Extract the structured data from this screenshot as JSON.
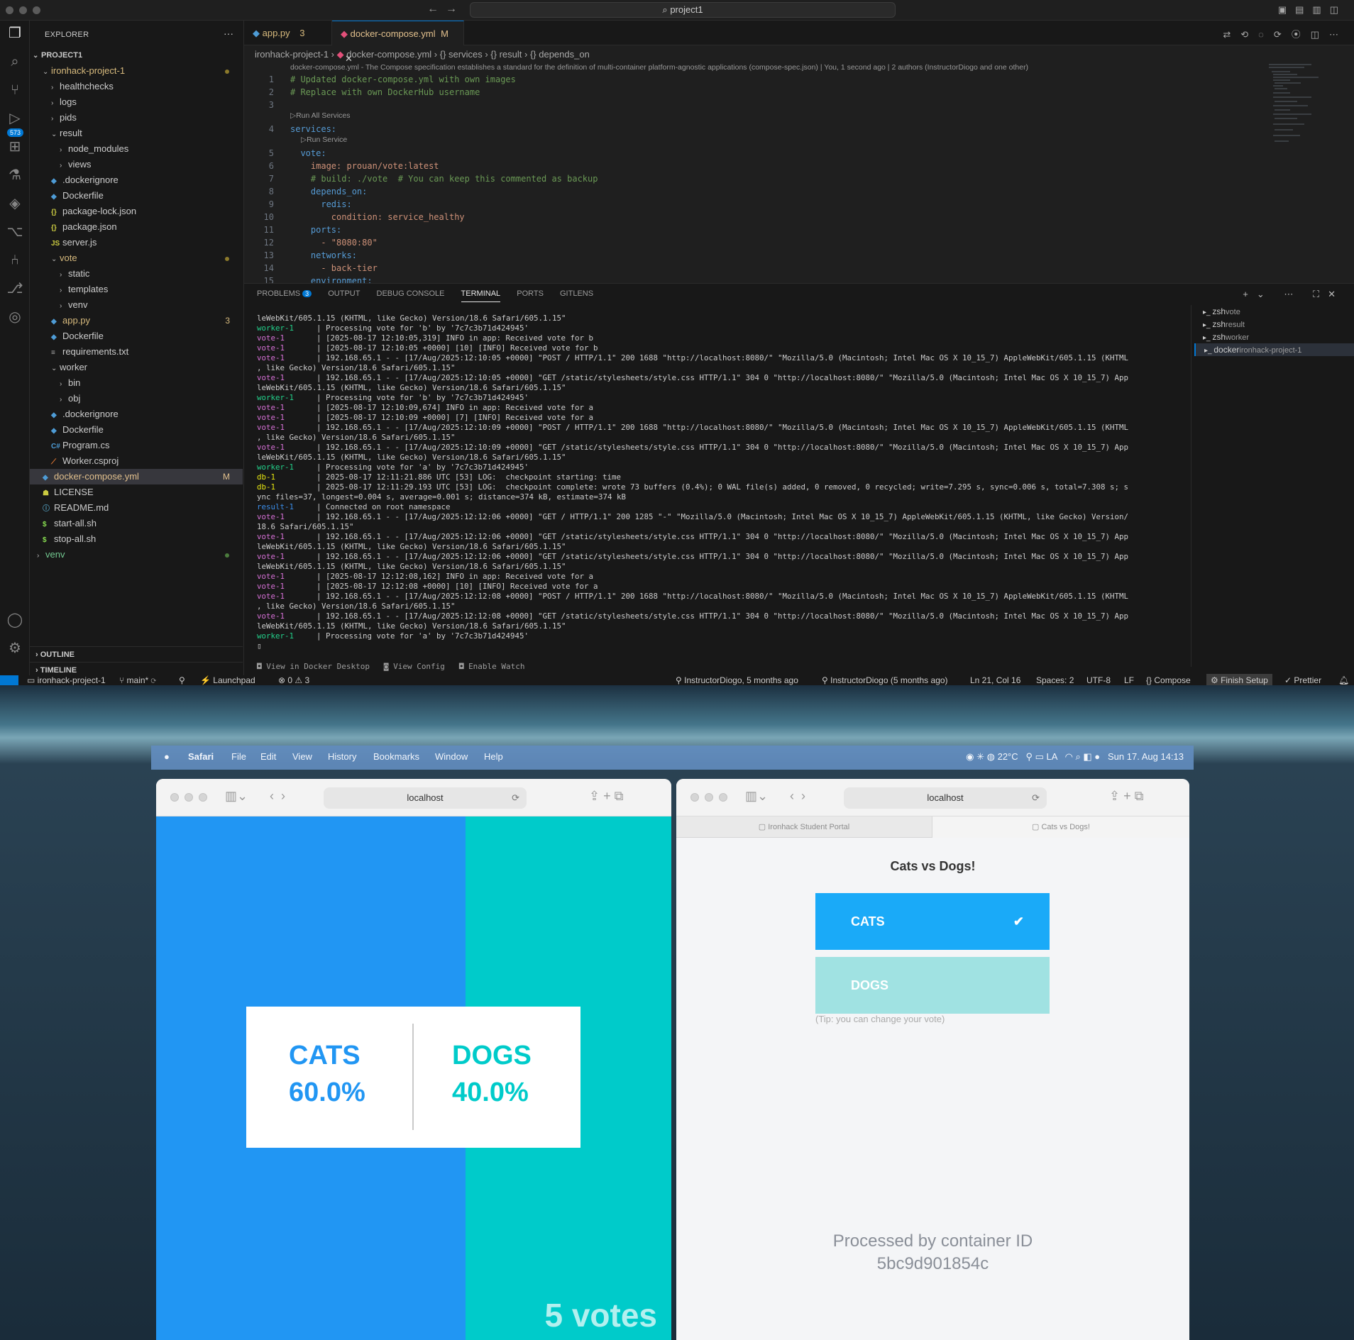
{
  "vscode": {
    "title_search": "project1",
    "explorer": {
      "header": "EXPLORER",
      "root": "PROJECT1",
      "items": [
        {
          "label": "ironhack-project-1",
          "kind": "folder-open",
          "depth": 0,
          "color": "#d7ba7d",
          "dot": "mod"
        },
        {
          "label": "healthchecks",
          "kind": "folder",
          "depth": 1
        },
        {
          "label": "logs",
          "kind": "folder",
          "depth": 1
        },
        {
          "label": "pids",
          "kind": "folder",
          "depth": 1
        },
        {
          "label": "result",
          "kind": "folder-open",
          "depth": 1
        },
        {
          "label": "node_modules",
          "kind": "folder",
          "depth": 2
        },
        {
          "label": "views",
          "kind": "folder",
          "depth": 2
        },
        {
          "label": ".dockerignore",
          "kind": "file",
          "depth": 1,
          "icon": "docker-icon"
        },
        {
          "label": "Dockerfile",
          "kind": "file",
          "depth": 1,
          "icon": "docker-icon"
        },
        {
          "label": "package-lock.json",
          "kind": "file",
          "depth": 1,
          "icon": "json-icon"
        },
        {
          "label": "package.json",
          "kind": "file",
          "depth": 1,
          "icon": "json-icon"
        },
        {
          "label": "server.js",
          "kind": "file",
          "depth": 1,
          "icon": "js-icon"
        },
        {
          "label": "vote",
          "kind": "folder-open",
          "depth": 1,
          "color": "#d7ba7d",
          "dot": "mod"
        },
        {
          "label": "static",
          "kind": "folder",
          "depth": 2
        },
        {
          "label": "templates",
          "kind": "folder",
          "depth": 2
        },
        {
          "label": "venv",
          "kind": "folder",
          "depth": 2
        },
        {
          "label": "app.py",
          "kind": "file",
          "depth": 1,
          "icon": "python-icon",
          "color": "#d7ba7d",
          "status": "3"
        },
        {
          "label": "Dockerfile",
          "kind": "file",
          "depth": 1,
          "icon": "docker-icon"
        },
        {
          "label": "requirements.txt",
          "kind": "file",
          "depth": 1,
          "icon": "text-icon"
        },
        {
          "label": "worker",
          "kind": "folder-open",
          "depth": 1
        },
        {
          "label": "bin",
          "kind": "folder",
          "depth": 2
        },
        {
          "label": "obj",
          "kind": "folder",
          "depth": 2
        },
        {
          "label": ".dockerignore",
          "kind": "file",
          "depth": 1,
          "icon": "docker-icon"
        },
        {
          "label": "Dockerfile",
          "kind": "file",
          "depth": 1,
          "icon": "docker-icon"
        },
        {
          "label": "Program.cs",
          "kind": "file",
          "depth": 1,
          "icon": "csharp-icon"
        },
        {
          "label": "Worker.csproj",
          "kind": "file",
          "depth": 1,
          "icon": "xml-icon"
        },
        {
          "label": "docker-compose.yml",
          "kind": "file",
          "depth": 0,
          "icon": "docker-icon",
          "color": "#e2c08d",
          "status": "M",
          "selected": true
        },
        {
          "label": "LICENSE",
          "kind": "file",
          "depth": 0,
          "icon": "license-icon"
        },
        {
          "label": "README.md",
          "kind": "file",
          "depth": 0,
          "icon": "info-icon"
        },
        {
          "label": "start-all.sh",
          "kind": "file",
          "depth": 0,
          "icon": "shell-icon"
        },
        {
          "label": "stop-all.sh",
          "kind": "file",
          "depth": 0,
          "icon": "shell-icon"
        },
        {
          "label": "venv",
          "kind": "folder",
          "depth": -1,
          "color": "#73c991",
          "dot": "green"
        }
      ],
      "outline": "OUTLINE",
      "timeline": "TIMELINE"
    },
    "activity": {
      "scm_badge": "573"
    },
    "tabs": [
      {
        "label": "app.py",
        "badge": "3",
        "active": false
      },
      {
        "label": "docker-compose.yml",
        "badge": "M",
        "active": true
      }
    ],
    "breadcrumb": [
      "ironhack-project-1",
      "docker-compose.yml",
      "{} services",
      "{} result",
      "{} depends_on"
    ],
    "codelens_top": "docker-compose.yml - The Compose specification establishes a standard for the definition of multi-container platform-agnostic applications (compose-spec.json) | You, 1 second ago | 2 authors (InstructorDiogo and one other)",
    "code_lines": [
      {
        "n": "1",
        "t": "# Updated docker-compose.yml with own images",
        "c": "#6a9955"
      },
      {
        "n": "2",
        "t": "# Replace with own DockerHub username",
        "c": "#6a9955"
      },
      {
        "n": "3",
        "t": "",
        "c": "#cccccc"
      },
      {
        "n": "4",
        "t": "services:",
        "c": "#569cd6",
        "lens": "▷Run All Services"
      },
      {
        "n": "5",
        "t": "  vote:",
        "c": "#569cd6",
        "lens": "▷Run Service"
      },
      {
        "n": "6",
        "t": "    image: prouan/vote:latest",
        "c": "#ce9178"
      },
      {
        "n": "7",
        "t": "    # build: ./vote  # You can keep this commented as backup",
        "c": "#6a9955"
      },
      {
        "n": "8",
        "t": "    depends_on:",
        "c": "#569cd6"
      },
      {
        "n": "9",
        "t": "      redis:",
        "c": "#569cd6"
      },
      {
        "n": "10",
        "t": "        condition: service_healthy",
        "c": "#ce9178"
      },
      {
        "n": "11",
        "t": "    ports:",
        "c": "#569cd6"
      },
      {
        "n": "12",
        "t": "      - \"8080:80\"",
        "c": "#ce9178"
      },
      {
        "n": "13",
        "t": "    networks:",
        "c": "#569cd6"
      },
      {
        "n": "14",
        "t": "      - back-tier",
        "c": "#ce9178"
      },
      {
        "n": "15",
        "t": "    environment:",
        "c": "#569cd6"
      }
    ],
    "panel_tabs": [
      {
        "label": "PROBLEMS",
        "badge": "3"
      },
      {
        "label": "OUTPUT"
      },
      {
        "label": "DEBUG CONSOLE"
      },
      {
        "label": "TERMINAL",
        "active": true
      },
      {
        "label": "PORTS"
      },
      {
        "label": "GITLENS"
      }
    ],
    "terminal_lines": [
      {
        "svc": "",
        "c": "#cccccc",
        "t": "leWebKit/605.1.15 (KHTML, like Gecko) Version/18.6 Safari/605.1.15\""
      },
      {
        "svc": "worker-1",
        "c": "#23d18b",
        "t": "| Processing vote for 'b' by '7c7c3b71d424945'"
      },
      {
        "svc": "vote-1",
        "c": "#d670d6",
        "t": "| [2025-08-17 12:10:05,319] INFO in app: Received vote for b"
      },
      {
        "svc": "vote-1",
        "c": "#d670d6",
        "t": "| [2025-08-17 12:10:05 +0000] [10] [INFO] Received vote for b"
      },
      {
        "svc": "vote-1",
        "c": "#d670d6",
        "t": "| 192.168.65.1 - - [17/Aug/2025:12:10:05 +0000] \"POST / HTTP/1.1\" 200 1688 \"http://localhost:8080/\" \"Mozilla/5.0 (Macintosh; Intel Mac OS X 10_15_7) AppleWebKit/605.1.15 (KHTML"
      },
      {
        "svc": "",
        "c": "#cccccc",
        "t": ", like Gecko) Version/18.6 Safari/605.1.15\""
      },
      {
        "svc": "vote-1",
        "c": "#d670d6",
        "t": "| 192.168.65.1 - - [17/Aug/2025:12:10:05 +0000] \"GET /static/stylesheets/style.css HTTP/1.1\" 304 0 \"http://localhost:8080/\" \"Mozilla/5.0 (Macintosh; Intel Mac OS X 10_15_7) App"
      },
      {
        "svc": "",
        "c": "#cccccc",
        "t": "leWebKit/605.1.15 (KHTML, like Gecko) Version/18.6 Safari/605.1.15\""
      },
      {
        "svc": "worker-1",
        "c": "#23d18b",
        "t": "| Processing vote for 'b' by '7c7c3b71d424945'"
      },
      {
        "svc": "vote-1",
        "c": "#d670d6",
        "t": "| [2025-08-17 12:10:09,674] INFO in app: Received vote for a"
      },
      {
        "svc": "vote-1",
        "c": "#d670d6",
        "t": "| [2025-08-17 12:10:09 +0000] [7] [INFO] Received vote for a"
      },
      {
        "svc": "vote-1",
        "c": "#d670d6",
        "t": "| 192.168.65.1 - - [17/Aug/2025:12:10:09 +0000] \"POST / HTTP/1.1\" 200 1688 \"http://localhost:8080/\" \"Mozilla/5.0 (Macintosh; Intel Mac OS X 10_15_7) AppleWebKit/605.1.15 (KHTML"
      },
      {
        "svc": "",
        "c": "#cccccc",
        "t": ", like Gecko) Version/18.6 Safari/605.1.15\""
      },
      {
        "svc": "vote-1",
        "c": "#d670d6",
        "t": "| 192.168.65.1 - - [17/Aug/2025:12:10:09 +0000] \"GET /static/stylesheets/style.css HTTP/1.1\" 304 0 \"http://localhost:8080/\" \"Mozilla/5.0 (Macintosh; Intel Mac OS X 10_15_7) App"
      },
      {
        "svc": "",
        "c": "#cccccc",
        "t": "leWebKit/605.1.15 (KHTML, like Gecko) Version/18.6 Safari/605.1.15\""
      },
      {
        "svc": "worker-1",
        "c": "#23d18b",
        "t": "| Processing vote for 'a' by '7c7c3b71d424945'"
      },
      {
        "svc": "db-1",
        "c": "#e5e510",
        "t": "| 2025-08-17 12:11:21.886 UTC [53] LOG:  checkpoint starting: time"
      },
      {
        "svc": "db-1",
        "c": "#e5e510",
        "t": "| 2025-08-17 12:11:29.193 UTC [53] LOG:  checkpoint complete: wrote 73 buffers (0.4%); 0 WAL file(s) added, 0 removed, 0 recycled; write=7.295 s, sync=0.006 s, total=7.308 s; s"
      },
      {
        "svc": "",
        "c": "#cccccc",
        "t": "ync files=37, longest=0.004 s, average=0.001 s; distance=374 kB, estimate=374 kB"
      },
      {
        "svc": "result-1",
        "c": "#3b8eea",
        "t": "| Connected on root namespace"
      },
      {
        "svc": "vote-1",
        "c": "#d670d6",
        "t": "| 192.168.65.1 - - [17/Aug/2025:12:12:06 +0000] \"GET / HTTP/1.1\" 200 1285 \"-\" \"Mozilla/5.0 (Macintosh; Intel Mac OS X 10_15_7) AppleWebKit/605.1.15 (KHTML, like Gecko) Version/"
      },
      {
        "svc": "",
        "c": "#cccccc",
        "t": "18.6 Safari/605.1.15\""
      },
      {
        "svc": "vote-1",
        "c": "#d670d6",
        "t": "| 192.168.65.1 - - [17/Aug/2025:12:12:06 +0000] \"GET /static/stylesheets/style.css HTTP/1.1\" 304 0 \"http://localhost:8080/\" \"Mozilla/5.0 (Macintosh; Intel Mac OS X 10_15_7) App"
      },
      {
        "svc": "",
        "c": "#cccccc",
        "t": "leWebKit/605.1.15 (KHTML, like Gecko) Version/18.6 Safari/605.1.15\""
      },
      {
        "svc": "vote-1",
        "c": "#d670d6",
        "t": "| 192.168.65.1 - - [17/Aug/2025:12:12:06 +0000] \"GET /static/stylesheets/style.css HTTP/1.1\" 304 0 \"http://localhost:8080/\" \"Mozilla/5.0 (Macintosh; Intel Mac OS X 10_15_7) App"
      },
      {
        "svc": "",
        "c": "#cccccc",
        "t": "leWebKit/605.1.15 (KHTML, like Gecko) Version/18.6 Safari/605.1.15\""
      },
      {
        "svc": "vote-1",
        "c": "#d670d6",
        "t": "| [2025-08-17 12:12:08,162] INFO in app: Received vote for a"
      },
      {
        "svc": "vote-1",
        "c": "#d670d6",
        "t": "| [2025-08-17 12:12:08 +0000] [10] [INFO] Received vote for a"
      },
      {
        "svc": "vote-1",
        "c": "#d670d6",
        "t": "| 192.168.65.1 - - [17/Aug/2025:12:12:08 +0000] \"POST / HTTP/1.1\" 200 1688 \"http://localhost:8080/\" \"Mozilla/5.0 (Macintosh; Intel Mac OS X 10_15_7) AppleWebKit/605.1.15 (KHTML"
      },
      {
        "svc": "",
        "c": "#cccccc",
        "t": ", like Gecko) Version/18.6 Safari/605.1.15\""
      },
      {
        "svc": "vote-1",
        "c": "#d670d6",
        "t": "| 192.168.65.1 - - [17/Aug/2025:12:12:08 +0000] \"GET /static/stylesheets/style.css HTTP/1.1\" 304 0 \"http://localhost:8080/\" \"Mozilla/5.0 (Macintosh; Intel Mac OS X 10_15_7) App"
      },
      {
        "svc": "",
        "c": "#cccccc",
        "t": "leWebKit/605.1.15 (KHTML, like Gecko) Version/18.6 Safari/605.1.15\""
      },
      {
        "svc": "worker-1",
        "c": "#23d18b",
        "t": "| Processing vote for 'a' by '7c7c3b71d424945'"
      },
      {
        "svc": "",
        "c": "#cccccc",
        "t": "▯"
      }
    ],
    "terminal_sessions": [
      {
        "shell": "zsh",
        "name": "vote"
      },
      {
        "shell": "zsh",
        "name": "result"
      },
      {
        "shell": "zsh",
        "name": "worker"
      },
      {
        "shell": "docker",
        "name": "ironhack-project-1",
        "selected": true
      }
    ],
    "terminal_bottom": [
      "View in Docker Desktop",
      "View Config",
      "Enable Watch"
    ],
    "status": {
      "project": "ironhack-project-1",
      "branch": "main*",
      "launchpad": "Launchpad",
      "problems": "⊗ 0 ⚠ 3",
      "blame": "InstructorDiogo, 5 months ago",
      "blame2": "InstructorDiogo (5 months ago)",
      "position": "Ln 21, Col 16",
      "spaces": "Spaces: 2",
      "encoding": "UTF-8",
      "eol": "LF",
      "language": "{} Compose",
      "finish": "Finish Setup",
      "prettier": "Prettier"
    }
  },
  "macos": {
    "menu": [
      "Safari",
      "File",
      "Edit",
      "View",
      "History",
      "Bookmarks",
      "Window",
      "Help"
    ],
    "weather": "22°C",
    "input": "LA",
    "datetime": "Sun 17. Aug  14:13"
  },
  "safari_left": {
    "url": "localhost",
    "result": {
      "cats_label": "CATS",
      "cats_pct": "60.0%",
      "dogs_label": "DOGS",
      "dogs_pct": "40.0%",
      "votes": "5 votes",
      "cats_color": "#2196f3",
      "dogs_color": "#00cbca"
    }
  },
  "safari_right": {
    "url": "localhost",
    "tabs": [
      "Ironhack Student Portal",
      "Cats vs Dogs!"
    ],
    "vote": {
      "title": "Cats vs Dogs!",
      "option_a": "CATS",
      "option_b": "DOGS",
      "tip": "(Tip: you can change your vote)",
      "processed_label": "Processed by container ID",
      "container_id": "5bc9d901854c"
    }
  }
}
